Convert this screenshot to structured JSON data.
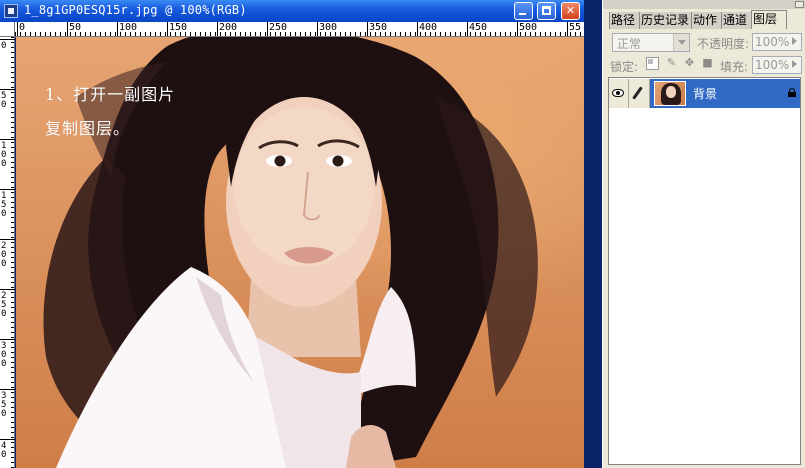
{
  "document": {
    "title": "1_8g1GP0ESQ15r.jpg @ 100%(RGB)",
    "window_buttons": [
      "minimize",
      "maximize",
      "close"
    ],
    "close_glyph": "✕",
    "ruler_top_labels": [
      "0",
      "50",
      "100",
      "150",
      "200",
      "250",
      "300",
      "350",
      "400",
      "450",
      "500",
      "55"
    ],
    "ruler_left_labels": [
      "0",
      "50",
      "100",
      "150",
      "200",
      "250",
      "300",
      "350",
      "40"
    ],
    "canvas_text": {
      "line1": "1、打开一副图片",
      "line2": "复制图层。"
    }
  },
  "layers_panel": {
    "tabs": [
      {
        "label": "路径",
        "active": false
      },
      {
        "label": "历史记录",
        "active": false
      },
      {
        "label": "动作",
        "active": false
      },
      {
        "label": "通道",
        "active": false
      },
      {
        "label": "图层",
        "active": true
      }
    ],
    "blend_mode": "正常",
    "opacity_label": "不透明度:",
    "opacity_value": "100%",
    "lock_label": "锁定:",
    "fill_label": "填充:",
    "fill_value": "100%",
    "layers": [
      {
        "name": "背景",
        "visible": true,
        "selected": true,
        "locked": true
      }
    ]
  },
  "colors": {
    "title_bar": "#0e4fd3",
    "selection": "#316ac5",
    "panel_bg": "#ece9d8",
    "close_button": "#d2421e"
  },
  "icons": [
    "app-icon",
    "minimize-icon",
    "maximize-icon",
    "close-icon",
    "panel-menu-arrow-icon",
    "eye-icon",
    "brush-icon",
    "lock-transparent-icon",
    "lock-image-icon",
    "lock-position-icon",
    "lock-all-icon",
    "layer-lock-icon"
  ]
}
